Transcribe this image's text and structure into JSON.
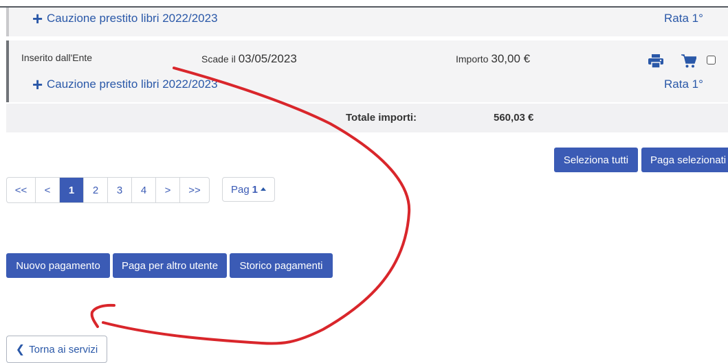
{
  "rows": [
    {
      "service": "Cauzione prestito libri 2022/2023",
      "rata": "Rata 1°"
    },
    {
      "inserted_by": "Inserito dall'Ente",
      "due_label": "Scade il",
      "due_date": "03/05/2023",
      "amount_label": "Importo",
      "amount": "30,00 €",
      "service": "Cauzione prestito libri 2022/2023",
      "rata": "Rata 1°"
    }
  ],
  "totals": {
    "label": "Totale importi:",
    "value": "560,03 €"
  },
  "selection": {
    "select_all": "Seleziona tutti",
    "pay_selected": "Paga selezionati"
  },
  "pagination": {
    "first": "<<",
    "prev": "<",
    "pages": [
      "1",
      "2",
      "3",
      "4"
    ],
    "next": ">",
    "last": ">>",
    "page_label": "Pag",
    "current": "1"
  },
  "actions": {
    "new_payment": "Nuovo pagamento",
    "pay_other": "Paga per altro utente",
    "history": "Storico pagamenti"
  },
  "back": {
    "label": "Torna ai servizi"
  },
  "colors": {
    "primary": "#3b5bb5",
    "link": "#2a58a8",
    "annotation": "#d9262b"
  },
  "icons": [
    "plus-icon",
    "printer-icon",
    "cart-icon",
    "caret-up-icon",
    "chevron-left-icon"
  ]
}
